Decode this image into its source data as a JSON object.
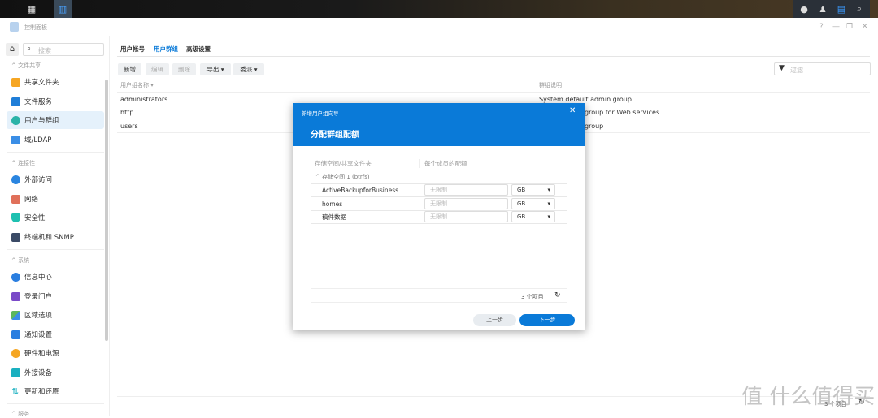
{
  "taskbar": {
    "icons": [
      "apps-grid-icon",
      "control-panel-icon"
    ],
    "tray": [
      "chat-icon",
      "user-icon",
      "widgets-icon",
      "search-icon"
    ]
  },
  "window": {
    "title": "控制面板",
    "controls": [
      "?",
      "—",
      "❐",
      "✕"
    ]
  },
  "sidebar": {
    "search_placeholder": "搜索",
    "sections": [
      {
        "label": "文件共享",
        "items": [
          "共享文件夹",
          "文件服务",
          "用户与群组",
          "域/LDAP"
        ]
      },
      {
        "label": "连接性",
        "items": [
          "外部访问",
          "网络",
          "安全性",
          "终端机和 SNMP"
        ]
      },
      {
        "label": "系统",
        "items": [
          "信息中心",
          "登录门户",
          "区域选项",
          "通知设置",
          "硬件和电源",
          "外接设备",
          "更新和还原"
        ]
      },
      {
        "label": "服务",
        "items": []
      }
    ],
    "active": "用户与群组"
  },
  "tabs": [
    "用户帐号",
    "用户群组",
    "高级设置"
  ],
  "toolbar": {
    "buttons": [
      "新增",
      "编辑",
      "删除",
      "导出 ▾",
      "委派 ▾"
    ],
    "filter_placeholder": "过滤"
  },
  "table": {
    "columns": [
      "用户组名称 ▾",
      "群组说明"
    ],
    "rows": [
      [
        "administrators",
        "System default admin group"
      ],
      [
        "http",
        "group for Web services"
      ],
      [
        "users",
        "group"
      ]
    ],
    "count": "3 个项目"
  },
  "dialog": {
    "window_title": "新增用户组向导",
    "heading": "分配群组配额",
    "columns": [
      "存储空间/共享文件夹",
      "每个成员的配额"
    ],
    "group": "存储空间 1 (btrfs)",
    "rows": [
      {
        "name": "ActiveBackupforBusiness",
        "quota_placeholder": "无限制",
        "unit": "GB"
      },
      {
        "name": "homes",
        "quota_placeholder": "无限制",
        "unit": "GB"
      },
      {
        "name": "稿件数据",
        "quota_placeholder": "无限制",
        "unit": "GB"
      }
    ],
    "count": "3 个项目",
    "back": "上一步",
    "next": "下一步"
  },
  "watermark": "值 什么值得买"
}
